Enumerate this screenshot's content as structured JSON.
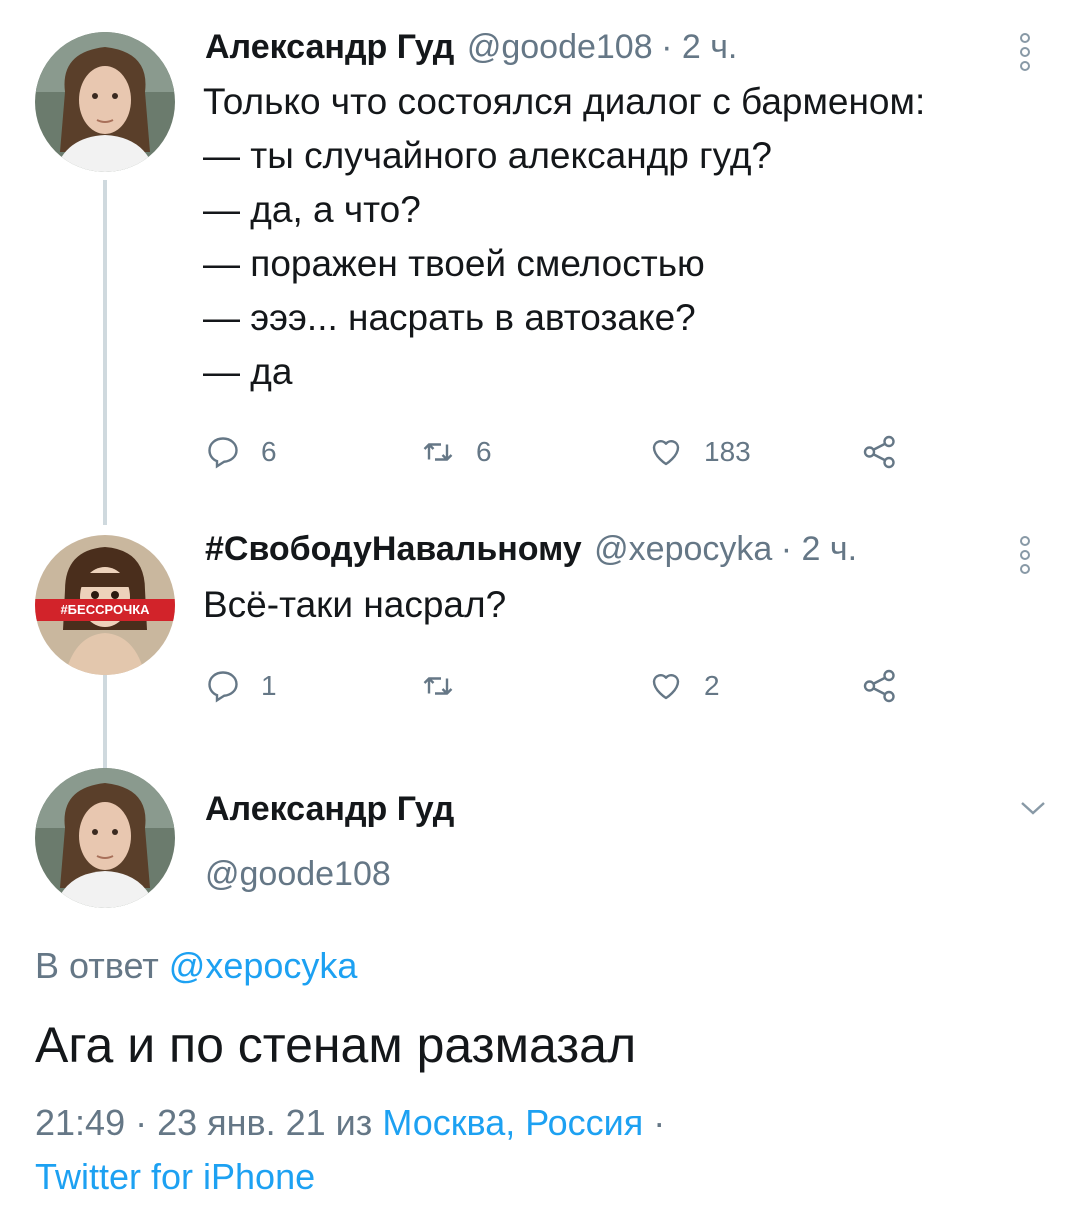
{
  "tweets": [
    {
      "author": "Александр Гуд",
      "handle": "@goode108",
      "time": "· 2 ч.",
      "text": "Только что состоялся диалог с барменом:\n— ты случайного александр гуд?\n— да, а что?\n— поражен твоей смелостью\n— эээ... насрать в автозаке?\n— да",
      "replies": "6",
      "retweets": "6",
      "likes": "183"
    },
    {
      "author": "#СвободуНавальному",
      "handle": "@xepocyka",
      "time": "· 2 ч.",
      "text": "Всё-таки насрал?",
      "replies": "1",
      "retweets": "",
      "likes": "2",
      "avatar_banner": "#БЕССРОЧКА"
    }
  ],
  "main": {
    "author": "Александр Гуд",
    "handle": "@goode108",
    "reply_prefix": "В ответ",
    "reply_to": "@xepocyka",
    "text": "Ага и по стенам размазал",
    "timestamp": "21:49 · 23 янв. 21 из",
    "location": "Москва, Россия",
    "separator": "·",
    "source": "Twitter for iPhone"
  },
  "icons": {
    "reply": "reply-icon",
    "retweet": "retweet-icon",
    "like": "heart-icon",
    "share": "share-icon",
    "menu": "kebab-icon",
    "expand": "chevron-down-icon"
  },
  "colors": {
    "accent": "#1da1f2",
    "muted": "#657786",
    "text": "#14171a",
    "thread_line": "#cfd9de",
    "banner_red": "#d2232a"
  }
}
